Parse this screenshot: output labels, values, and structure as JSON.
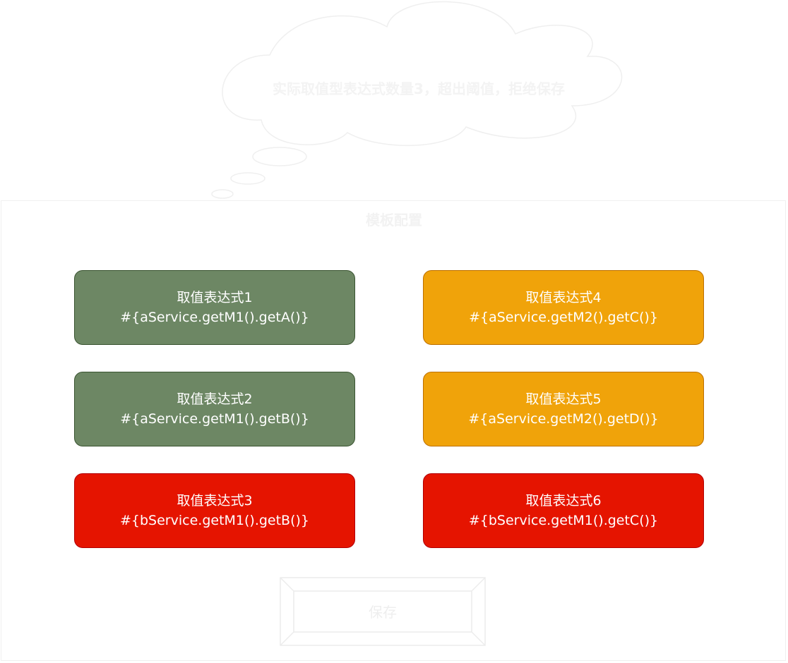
{
  "thought": {
    "message": "实际取值型表达式数量3，超出阈值，拒绝保存"
  },
  "template": {
    "title": "模板配置",
    "expressions": [
      {
        "name": "取值表达式1",
        "code": "#{aService.getM1().getA()}",
        "status": "valid"
      },
      {
        "name": "取值表达式2",
        "code": "#{aService.getM1().getB()}",
        "status": "valid"
      },
      {
        "name": "取值表达式3",
        "code": "#{bService.getM1().getB()}",
        "status": "exceeded"
      },
      {
        "name": "取值表达式4",
        "code": "#{aService.getM2().getC()}",
        "status": "pending"
      },
      {
        "name": "取值表达式5",
        "code": "#{aService.getM2().getD()}",
        "status": "pending"
      },
      {
        "name": "取值表达式6",
        "code": "#{bService.getM1().getC()}",
        "status": "exceeded"
      }
    ],
    "save_label": "保存"
  },
  "colors": {
    "valid_fill": "#6d8764",
    "pending_fill": "#f0a30a",
    "exceeded_fill": "#e51400"
  }
}
